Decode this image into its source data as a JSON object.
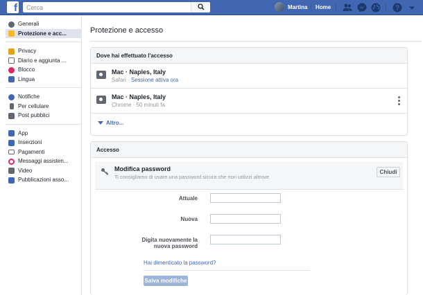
{
  "topbar": {
    "search_placeholder": "Cerca",
    "user_name": "Martina",
    "home_label": "Home",
    "icons": [
      "facebook-logo",
      "search-icon",
      "friend-requests-icon",
      "messenger-icon",
      "notifications-globe-icon",
      "help-icon",
      "dropdown-arrow-icon"
    ]
  },
  "sidebar": {
    "groups": [
      [
        {
          "label": "Generali",
          "icon": "gear-icon",
          "color": "#606770"
        },
        {
          "label": "Protezione e acc...",
          "icon": "shield-icon",
          "color": "#f7b928",
          "active": true
        }
      ],
      [
        {
          "label": "Privacy",
          "icon": "lock-icon",
          "color": "#e4a11b"
        },
        {
          "label": "Diario e aggiunta ...",
          "icon": "timeline-icon",
          "color": "#606770"
        },
        {
          "label": "Blocco",
          "icon": "block-icon",
          "color": "#e0245e"
        },
        {
          "label": "Lingua",
          "icon": "language-icon",
          "color": "#4267b2"
        }
      ],
      [
        {
          "label": "Notifiche",
          "icon": "globe-icon",
          "color": "#4267b2"
        },
        {
          "label": "Per cellulare",
          "icon": "mobile-icon",
          "color": "#606770"
        },
        {
          "label": "Post pubblici",
          "icon": "rss-icon",
          "color": "#606770"
        }
      ],
      [
        {
          "label": "App",
          "icon": "apps-icon",
          "color": "#4267b2"
        },
        {
          "label": "Inserzioni",
          "icon": "ads-icon",
          "color": "#4267b2"
        },
        {
          "label": "Pagamenti",
          "icon": "payments-icon",
          "color": "#606770"
        },
        {
          "label": "Messaggi assisten...",
          "icon": "support-icon",
          "color": "#e0245e"
        },
        {
          "label": "Video",
          "icon": "video-icon",
          "color": "#606770"
        },
        {
          "label": "Pubblicazioni asso...",
          "icon": "publications-icon",
          "color": "#4267b2"
        }
      ]
    ]
  },
  "main": {
    "title": "Protezione e accesso",
    "where_logged": {
      "heading": "Dove hai effettuato l'accesso",
      "sessions": [
        {
          "device": "Mac · Naples, Italy",
          "browser": "Safari",
          "dot": " · ",
          "status": "Sessione attiva ora"
        },
        {
          "device": "Mac · Naples, Italy",
          "browser": "Chrome",
          "dot": " · ",
          "status": "50 minuti fa"
        }
      ],
      "more_label": "Altro..."
    },
    "access": {
      "heading": "Accesso",
      "change_password_title": "Modifica password",
      "change_password_desc": "Ti consigliamo di usare una password sicura che non utilizzi altrove",
      "close_label": "Chiudi",
      "current_label": "Attuale",
      "current_value": "",
      "new_label": "Nuova",
      "new_value": "",
      "retype_label_line1": "Digita nuovamente la",
      "retype_label_line2": "nuova password",
      "retype_value": "",
      "forgot_label": "Hai dimenticato la password?",
      "save_label": "Salva modifiche"
    }
  },
  "colors": {
    "topbar": "#4267b2",
    "link": "#4267b2",
    "active_item_bg": "#dfe3ee",
    "save_disabled": "#9cb4d8"
  }
}
